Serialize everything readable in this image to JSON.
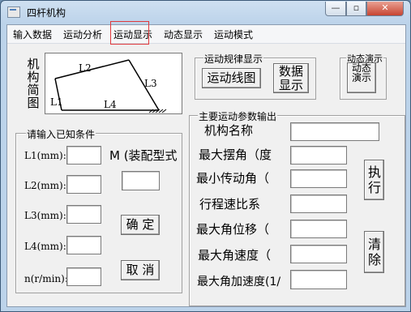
{
  "window": {
    "title": "四杆机构",
    "minimize_glyph": "—",
    "maximize_glyph": "▫",
    "close_glyph": "✕"
  },
  "menu": {
    "items": [
      "输入数据",
      "运动分析",
      "运动显示",
      "动态显示",
      "运动模式"
    ],
    "selected_index": 2
  },
  "mechanism": {
    "side_label": "机构简图",
    "links": [
      "L1",
      "L2",
      "L3",
      "L4"
    ]
  },
  "known_conditions": {
    "title": "请输入已知条件",
    "fields": [
      {
        "label": "L1(mm):",
        "value": ""
      },
      {
        "label": "L2(mm):",
        "value": ""
      },
      {
        "label": "L3(mm):",
        "value": ""
      },
      {
        "label": "L4(mm):",
        "value": ""
      },
      {
        "label": "n(r/min):",
        "value": ""
      }
    ],
    "mode_label": "M (装配型式",
    "mode_value": "",
    "confirm_label": "确 定",
    "cancel_label": "取 消"
  },
  "motion_law": {
    "title": "运动规律显示",
    "curve_button": "运动线图",
    "data_button": "数据显示"
  },
  "dynamic_demo": {
    "title": "动态演示",
    "button": "动态演示"
  },
  "main_params": {
    "title": "主要运动参数输出",
    "rows": [
      {
        "label": "机构名称",
        "value": ""
      },
      {
        "label": "最大摆角（度",
        "value": ""
      },
      {
        "label": "最小传动角（",
        "value": ""
      },
      {
        "label": "行程速比系",
        "value": ""
      },
      {
        "label": "最大角位移（",
        "value": ""
      },
      {
        "label": "最大角速度（",
        "value": ""
      },
      {
        "label": "最大角加速度(1/",
        "value": ""
      }
    ],
    "execute_button": "执行",
    "clear_button": "清除"
  }
}
